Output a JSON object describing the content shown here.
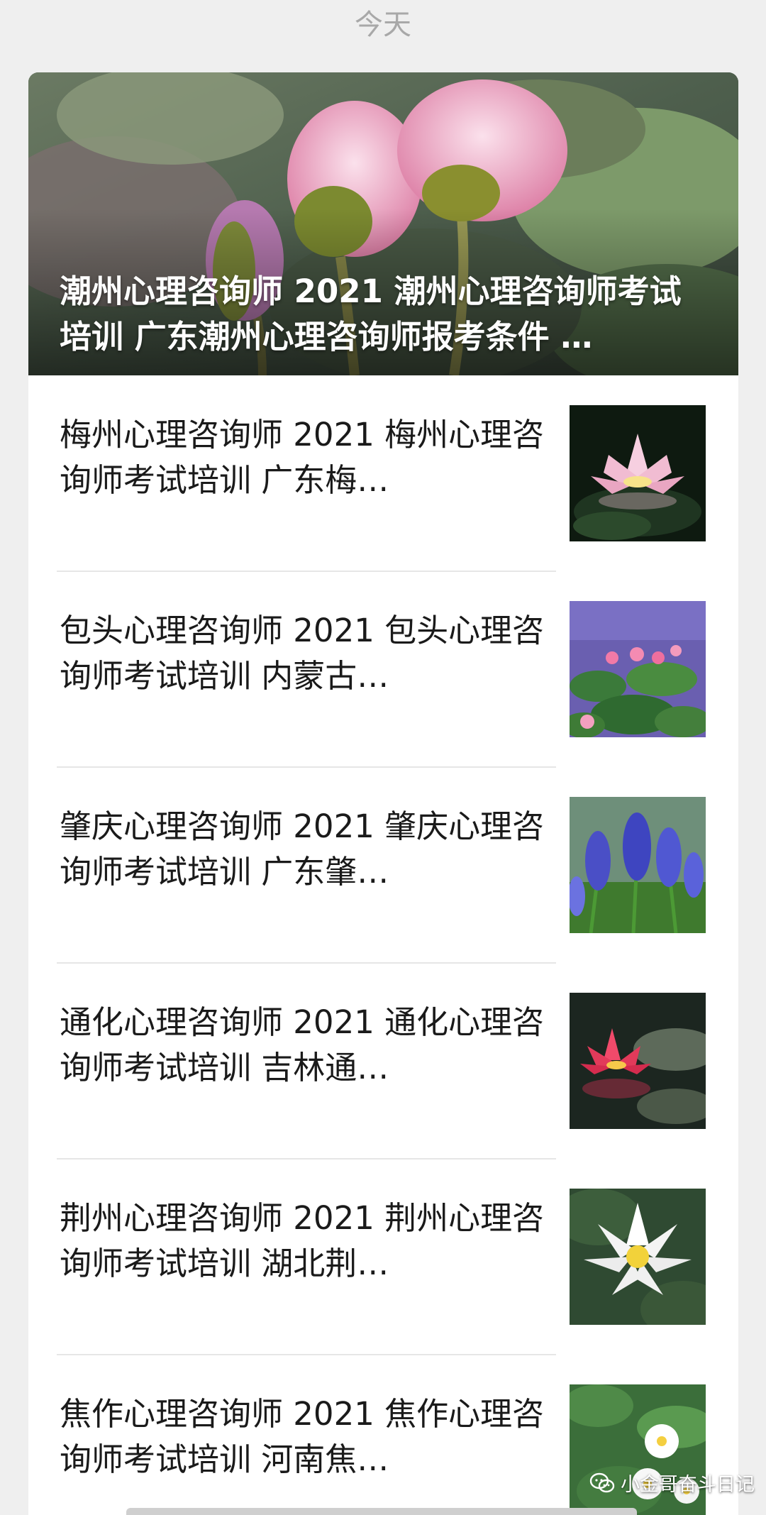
{
  "date_label": "今天",
  "hero": {
    "title": "潮州心理咨询师 2021 潮州心理咨询师考试培训 广东潮州心理咨询师报考条件 …"
  },
  "articles": [
    {
      "title": "梅州心理咨询师 2021 梅州心理咨询师考试培训 广东梅…",
      "thumb_icon": "pink-water-lily-image"
    },
    {
      "title": "包头心理咨询师 2021 包头心理咨询师考试培训 内蒙古…",
      "thumb_icon": "lotus-pond-image"
    },
    {
      "title": "肇庆心理咨询师 2021 肇庆心理咨询师考试培训 广东肇…",
      "thumb_icon": "grape-hyacinth-image"
    },
    {
      "title": "通化心理咨询师 2021 通化心理咨询师考试培训 吉林通…",
      "thumb_icon": "red-water-lily-image"
    },
    {
      "title": "荆州心理咨询师 2021 荆州心理咨询师考试培训 湖北荆…",
      "thumb_icon": "white-water-lily-image"
    },
    {
      "title": "焦作心理咨询师 2021 焦作心理咨询师考试培训 河南焦…",
      "thumb_icon": "white-lilies-image"
    }
  ],
  "watermark": {
    "text": "小金哥奋斗日记",
    "icon": "wechat-icon"
  }
}
